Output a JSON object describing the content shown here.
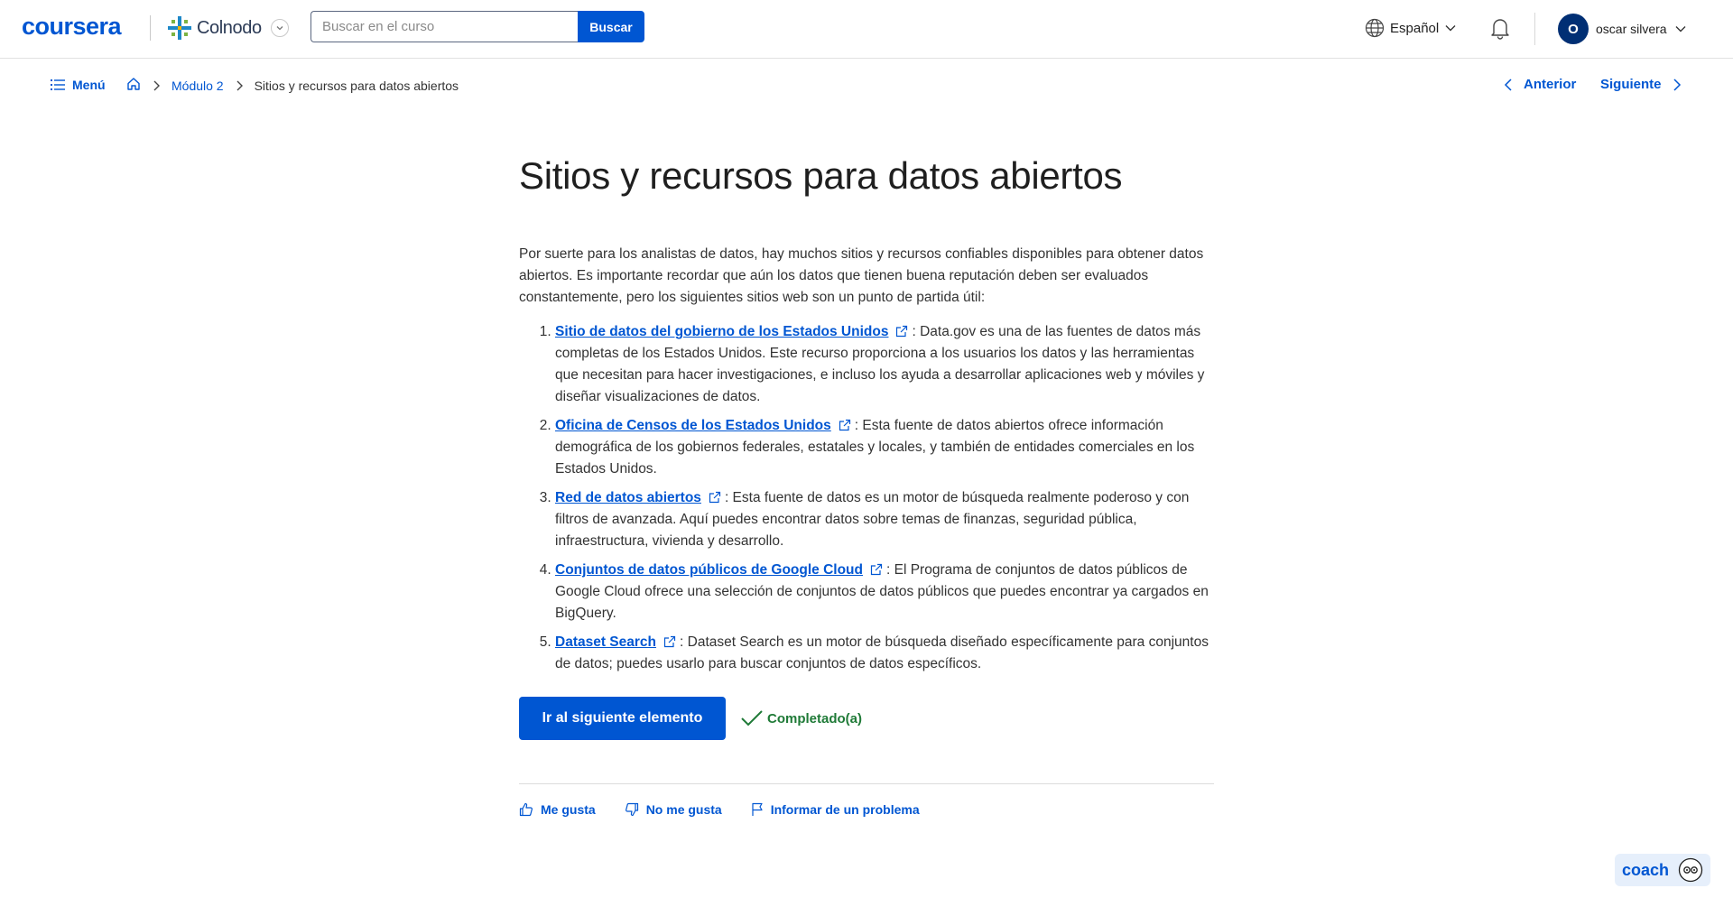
{
  "header": {
    "logo": "coursera",
    "partner": "Colnodo",
    "search": {
      "placeholder": "Buscar en el curso",
      "button": "Buscar"
    },
    "language": "Español",
    "user": {
      "initial": "O",
      "name": "oscar silvera"
    }
  },
  "subnav": {
    "menu": "Menú",
    "breadcrumb": {
      "module": "Módulo 2",
      "current": "Sitios y recursos para datos abiertos"
    },
    "prev": "Anterior",
    "next": "Siguiente"
  },
  "main": {
    "title": "Sitios y recursos para datos abiertos",
    "intro": "Por suerte para los analistas de datos, hay muchos sitios y recursos confiables disponibles para obtener datos abiertos. Es importante recordar que aún los datos que tienen buena reputación deben ser evaluados constantemente, pero los siguientes sitios web son un punto de partida útil:",
    "resources": [
      {
        "link": "Sitio de datos del gobierno de los Estados Unidos",
        "desc": ": Data.gov es una de las fuentes de datos más completas de los Estados Unidos. Este recurso proporciona a los usuarios los datos y las herramientas que necesitan para hacer investigaciones, e incluso los ayuda a desarrollar aplicaciones web y móviles y diseñar visualizaciones de datos."
      },
      {
        "link": "Oficina de Censos de los Estados Unidos",
        "desc": ": Esta fuente de datos abiertos ofrece información demográfica de los gobiernos federales, estatales y locales, y también de entidades comerciales en los Estados Unidos."
      },
      {
        "link": "Red de datos abiertos",
        "desc": ": Esta fuente de datos es un motor de búsqueda realmente poderoso y con filtros de avanzada. Aquí puedes encontrar datos sobre temas de finanzas, seguridad pública, infraestructura, vivienda y desarrollo."
      },
      {
        "link": "Conjuntos de datos públicos de Google Cloud",
        "desc": ": El Programa de conjuntos de datos públicos de Google Cloud ofrece una selección de conjuntos de datos públicos que puedes encontrar ya cargados en BigQuery."
      },
      {
        "link": "Dataset Search",
        "desc": ": Dataset Search es un motor de búsqueda diseñado específicamente para conjuntos de datos; puedes usarlo para buscar conjuntos de datos específicos."
      }
    ],
    "next_button": "Ir al siguiente elemento",
    "completed": "Completado(a)",
    "feedback": {
      "like": "Me gusta",
      "dislike": "No me gusta",
      "report": "Informar de un problema"
    }
  },
  "coach": {
    "label": "coach"
  },
  "colors": {
    "accent": "#0056d2",
    "success": "#1f7a37",
    "avatar": "#002f74"
  }
}
